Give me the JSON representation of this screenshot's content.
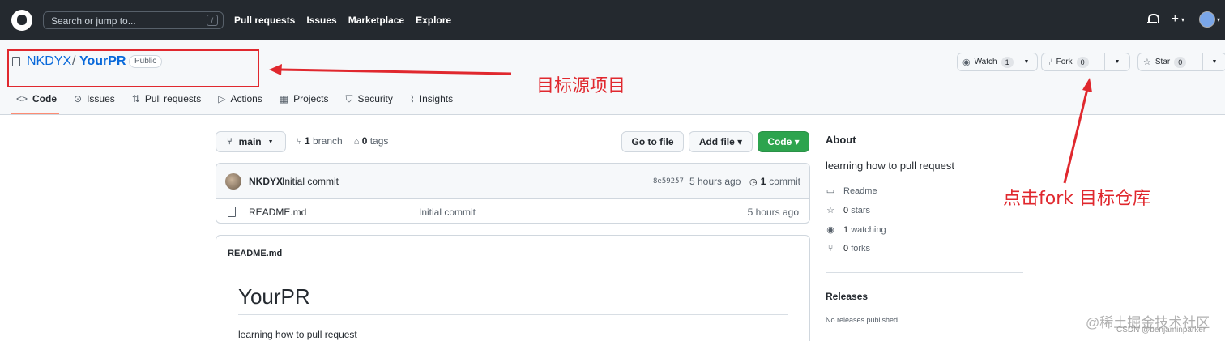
{
  "header": {
    "search_placeholder": "Search or jump to...",
    "search_shortcut": "/",
    "nav": [
      "Pull requests",
      "Issues",
      "Marketplace",
      "Explore"
    ],
    "plus": "+",
    "caret": "▾"
  },
  "repo": {
    "owner": "NKDYX",
    "separator": "/",
    "name": "YourPR",
    "visibility": "Public",
    "watch_label": "Watch",
    "watch_count": "1",
    "fork_label": "Fork",
    "fork_count": "0",
    "star_label": "Star",
    "star_count": "0",
    "dropdown": "▼"
  },
  "tabs": [
    {
      "label": "Code",
      "icon": "<>"
    },
    {
      "label": "Issues",
      "icon": "⊙"
    },
    {
      "label": "Pull requests",
      "icon": "⇅"
    },
    {
      "label": "Actions",
      "icon": "▷"
    },
    {
      "label": "Projects",
      "icon": "▦"
    },
    {
      "label": "Security",
      "icon": "⛉"
    },
    {
      "label": "Insights",
      "icon": "⌇"
    }
  ],
  "code": {
    "branch": "main",
    "branch_count": "1",
    "branch_label": "branch",
    "tag_count": "0",
    "tag_label": "tags",
    "goto_file": "Go to file",
    "add_file": "Add file ▾",
    "code_btn": "Code ▾"
  },
  "commit": {
    "author": "NKDYX",
    "message": "Initial commit",
    "sha": "8e59257",
    "time": "5 hours ago",
    "count": "1",
    "count_label": "commit"
  },
  "files": [
    {
      "name": "README.md",
      "message": "Initial commit",
      "time": "5 hours ago"
    }
  ],
  "readme": {
    "file_title": "README.md",
    "heading": "YourPR",
    "body": "learning how to pull request"
  },
  "about": {
    "title": "About",
    "description": "learning how to pull request",
    "readme_label": "Readme",
    "stars_count": "0",
    "stars_label": "stars",
    "watching_count": "1",
    "watching_label": "watching",
    "forks_count": "0",
    "forks_label": "forks"
  },
  "releases": {
    "title": "Releases",
    "none": "No releases published"
  },
  "annotations": {
    "source_repo": "目标源项目",
    "click_fork": "点击fork 目标仓库",
    "color": "#e0282e"
  },
  "watermark": {
    "line1": "@稀土掘金技术社区",
    "line2": "CSDN @benjaminparker"
  },
  "colors": {
    "header_bg": "#24292f",
    "link": "#0969da",
    "green": "#2da44e",
    "tab_underline": "#fd8c73"
  }
}
